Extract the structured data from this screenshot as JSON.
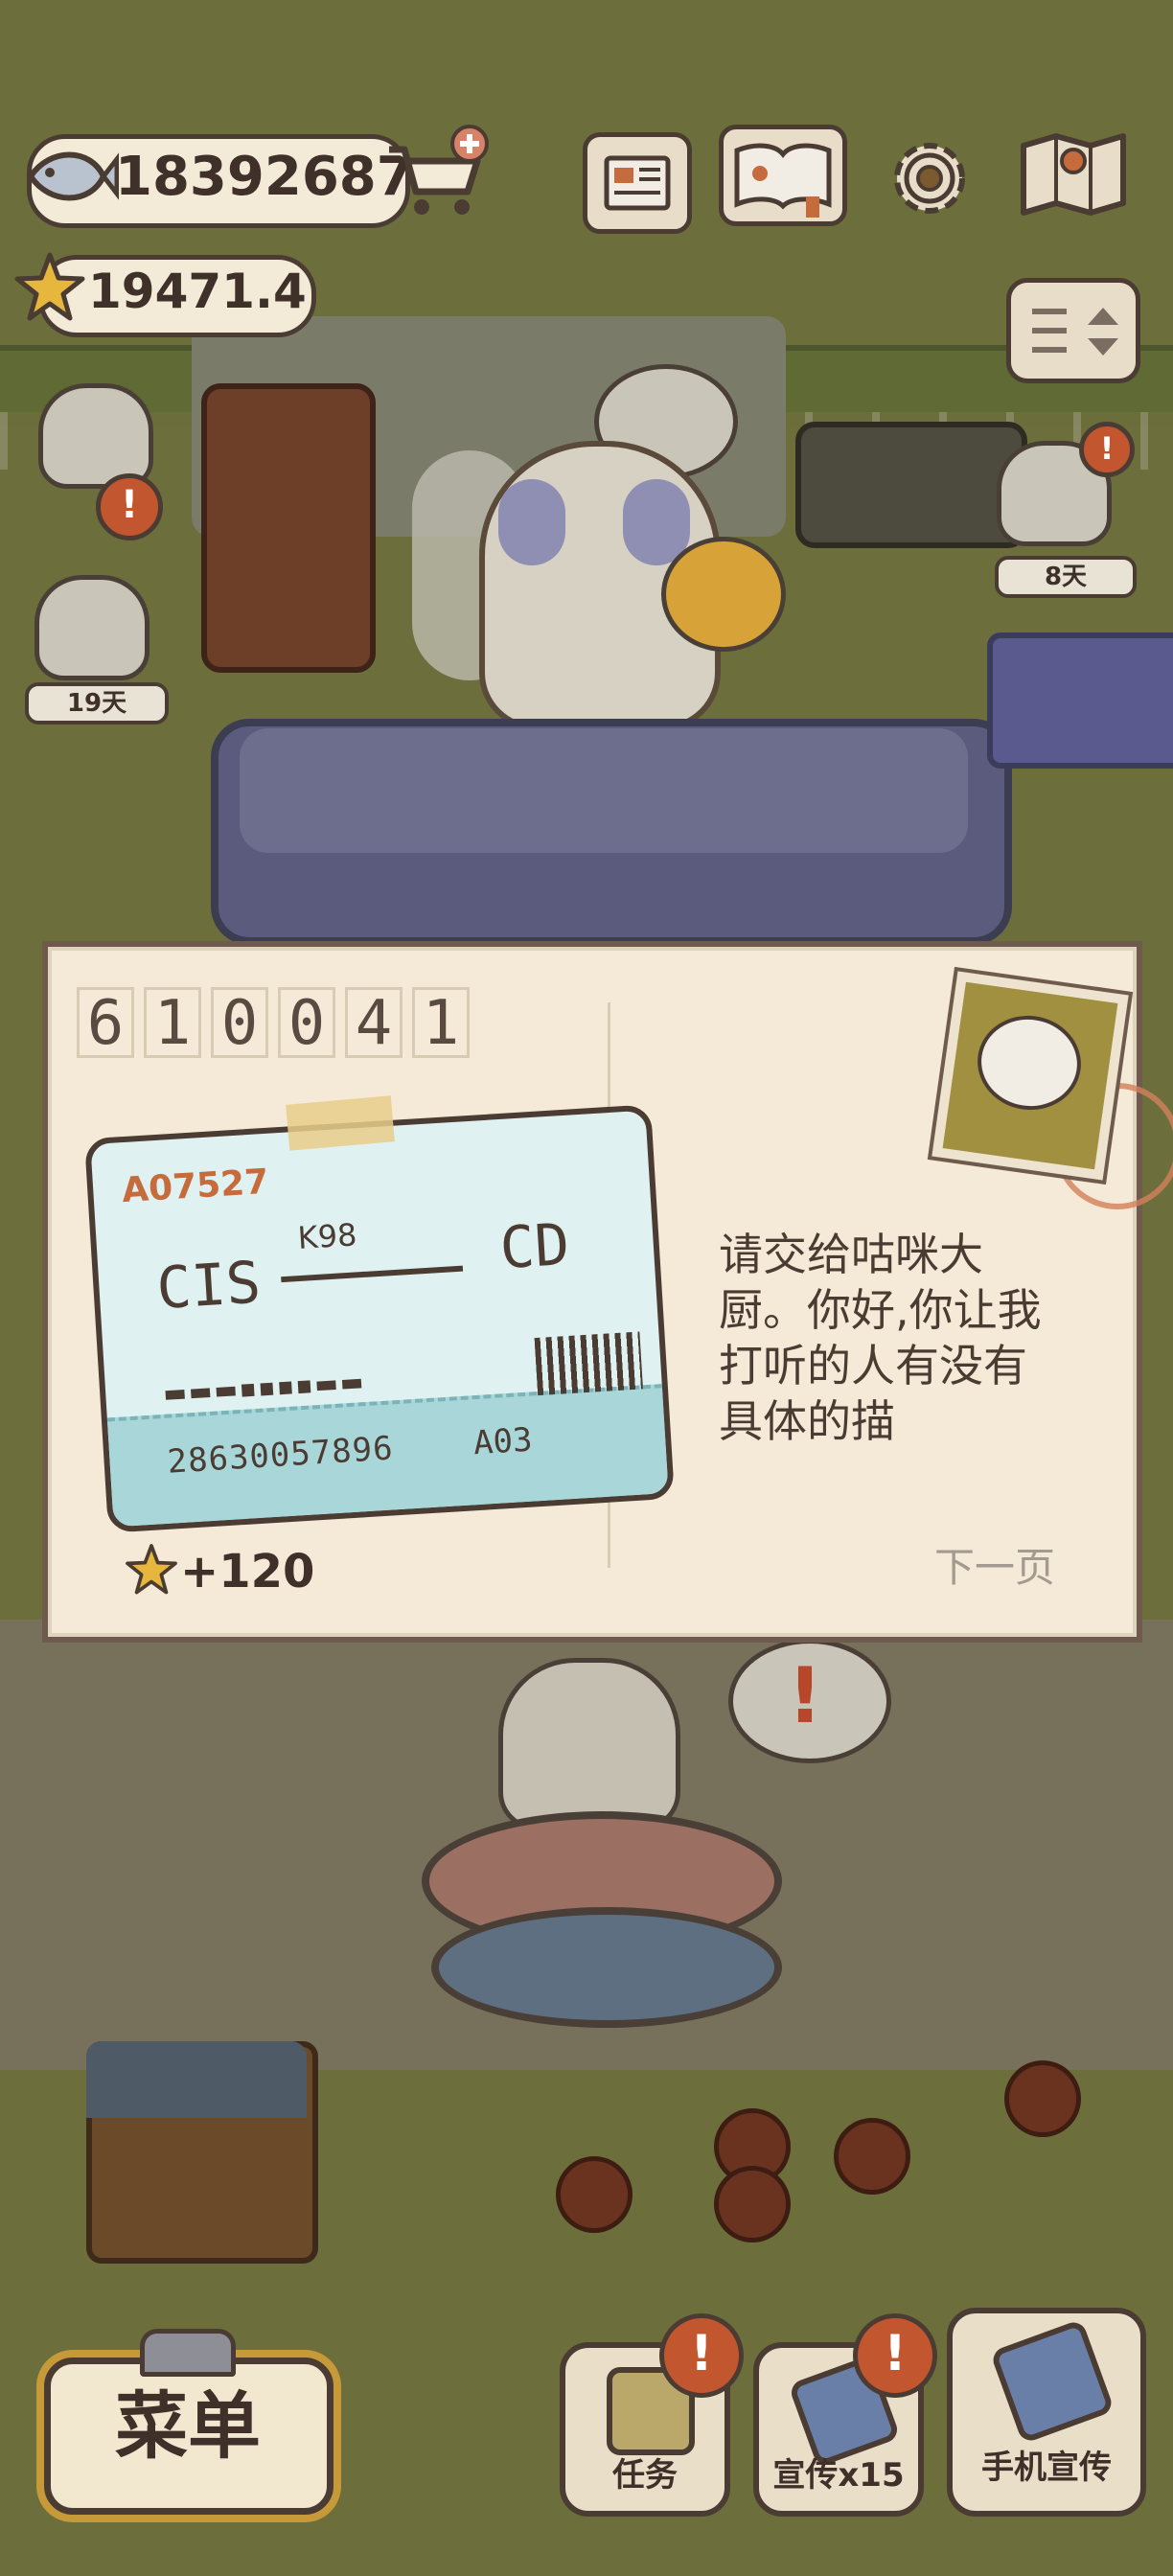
{
  "hud": {
    "fish_value": "18392687",
    "star_value": "19471.4",
    "icons": [
      "newspaper-icon",
      "paw-book-icon",
      "gear-icon",
      "map-icon",
      "scroll-arrows-icon",
      "cart-plus-icon"
    ]
  },
  "scene": {
    "day_tag_1": "19天",
    "day_tag_2": "8天",
    "alert_mark": "!"
  },
  "letter": {
    "postcode": [
      "6",
      "1",
      "0",
      "0",
      "4",
      "1"
    ],
    "ticket": {
      "code": "A07527",
      "from": "CIS",
      "train": "K98",
      "to": "CD",
      "dots": "▬▬▬▪▪▪▪▬▬",
      "number": "28630057896",
      "seat": "A03"
    },
    "message": "请交给咕咪大厨。你好,你让我打听的人有没有具体的描",
    "reward": "+120",
    "next_page": "下一页"
  },
  "bottom": {
    "menu_label": "菜单",
    "task_label": "任务",
    "promo_label": "宣传x15",
    "phone_label": "手机宣传"
  },
  "colors": {
    "grass": "#6c6f3c",
    "letter_bg": "#f5ead7",
    "text": "#3f302a",
    "alert": "#c2562f",
    "gold": "#c79a39"
  }
}
